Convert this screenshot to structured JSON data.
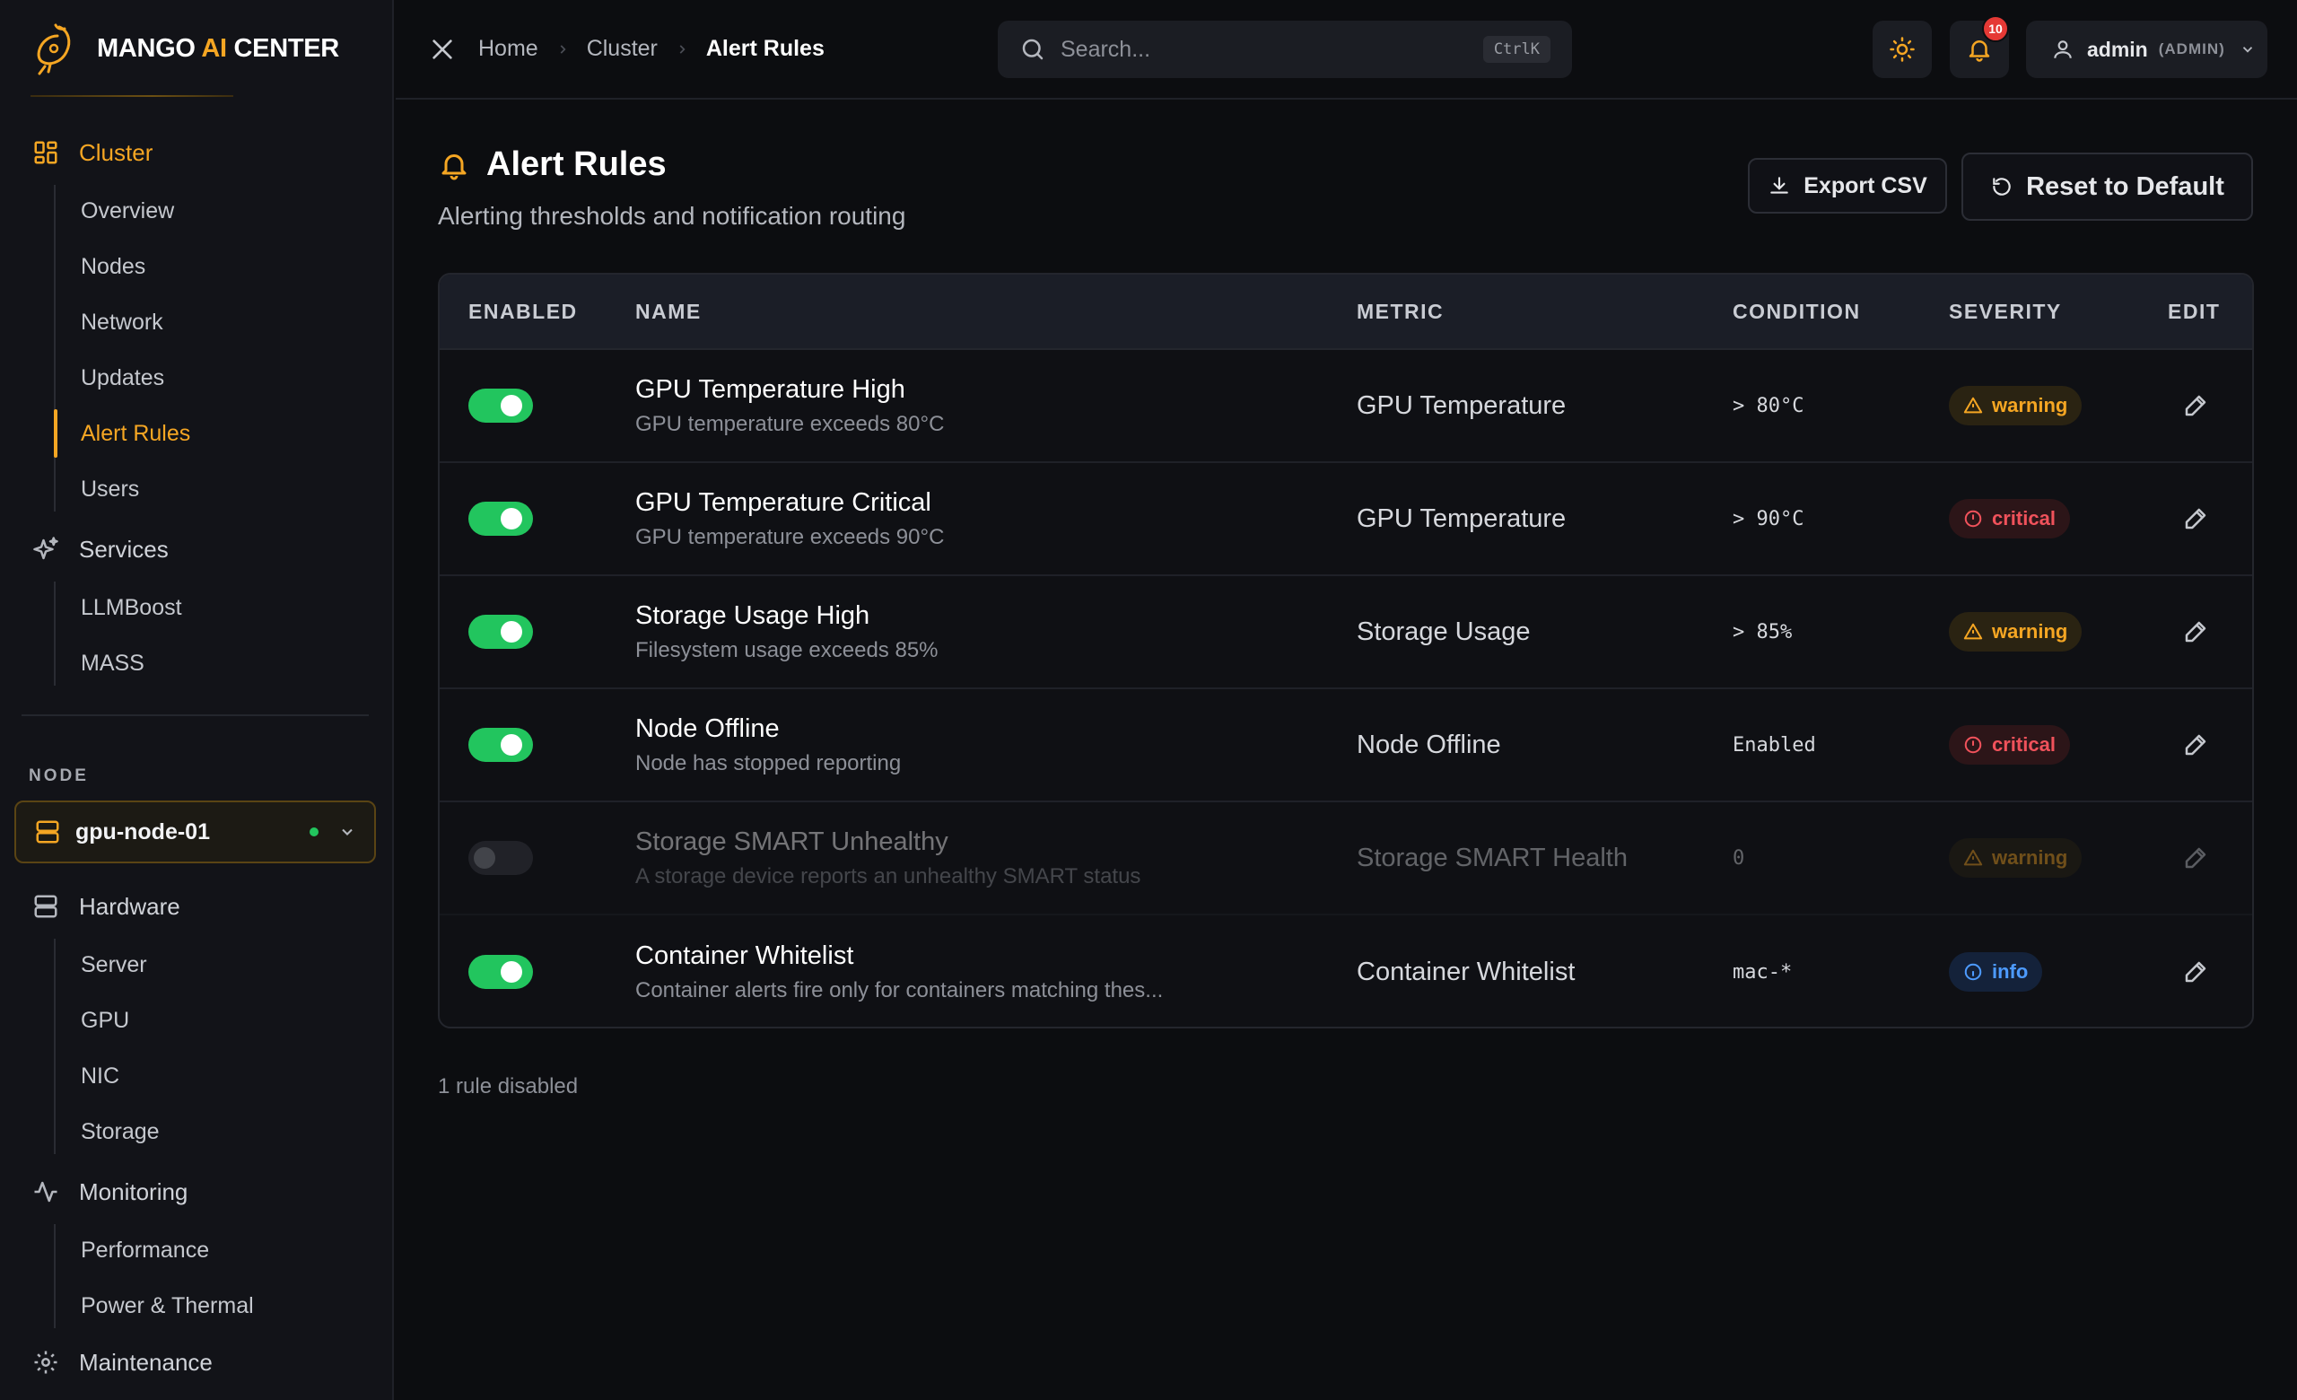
{
  "brand": {
    "name_prefix": "MANGO ",
    "name_ai": "AI",
    "name_suffix": " CENTER"
  },
  "sidebar": {
    "cluster": {
      "label": "Cluster",
      "items": [
        "Overview",
        "Nodes",
        "Network",
        "Updates",
        "Alert Rules",
        "Users"
      ],
      "active": "Alert Rules"
    },
    "services": {
      "label": "Services",
      "items": [
        "LLMBoost",
        "MASS"
      ]
    },
    "node_section_label": "NODE",
    "node_select": {
      "value": "gpu-node-01",
      "status": "online"
    },
    "hardware": {
      "label": "Hardware",
      "items": [
        "Server",
        "GPU",
        "NIC",
        "Storage"
      ]
    },
    "monitoring": {
      "label": "Monitoring",
      "items": [
        "Performance",
        "Power & Thermal"
      ]
    },
    "maintenance": {
      "label": "Maintenance"
    }
  },
  "topbar": {
    "breadcrumb": [
      "Home",
      "Cluster",
      "Alert Rules"
    ],
    "search": {
      "placeholder": "Search...",
      "shortcut": "CtrlK"
    },
    "notifications_count": "10",
    "user": {
      "name": "admin",
      "role": "(ADMIN)"
    }
  },
  "page": {
    "title": "Alert Rules",
    "subtitle": "Alerting thresholds and notification routing",
    "export_label": "Export CSV",
    "reset_label": "Reset to Default",
    "footer_note": "1 rule disabled"
  },
  "table": {
    "headers": {
      "enabled": "ENABLED",
      "name": "NAME",
      "metric": "METRIC",
      "condition": "CONDITION",
      "severity": "SEVERITY",
      "edit": "EDIT"
    },
    "rows": [
      {
        "enabled": true,
        "name": "GPU Temperature High",
        "description": "GPU temperature exceeds 80°C",
        "metric": "GPU Temperature",
        "condition": "> 80°C",
        "severity": "warning"
      },
      {
        "enabled": true,
        "name": "GPU Temperature Critical",
        "description": "GPU temperature exceeds 90°C",
        "metric": "GPU Temperature",
        "condition": "> 90°C",
        "severity": "critical"
      },
      {
        "enabled": true,
        "name": "Storage Usage High",
        "description": "Filesystem usage exceeds 85%",
        "metric": "Storage Usage",
        "condition": "> 85%",
        "severity": "warning"
      },
      {
        "enabled": true,
        "name": "Node Offline",
        "description": "Node has stopped reporting",
        "metric": "Node Offline",
        "condition": "Enabled",
        "severity": "critical"
      },
      {
        "enabled": false,
        "name": "Storage SMART Unhealthy",
        "description": "A storage device reports an unhealthy SMART status",
        "metric": "Storage SMART Health",
        "condition": "0",
        "severity": "warning"
      },
      {
        "enabled": true,
        "name": "Container Whitelist",
        "description": "Container alerts fire only for containers matching thes...",
        "metric": "Container Whitelist",
        "condition": "mac-*",
        "severity": "info"
      }
    ]
  },
  "colors": {
    "accent": "#f5a623",
    "toggle_on": "#22c55e",
    "warning": "#f5a623",
    "critical": "#f0525b",
    "info": "#4d9bff"
  }
}
